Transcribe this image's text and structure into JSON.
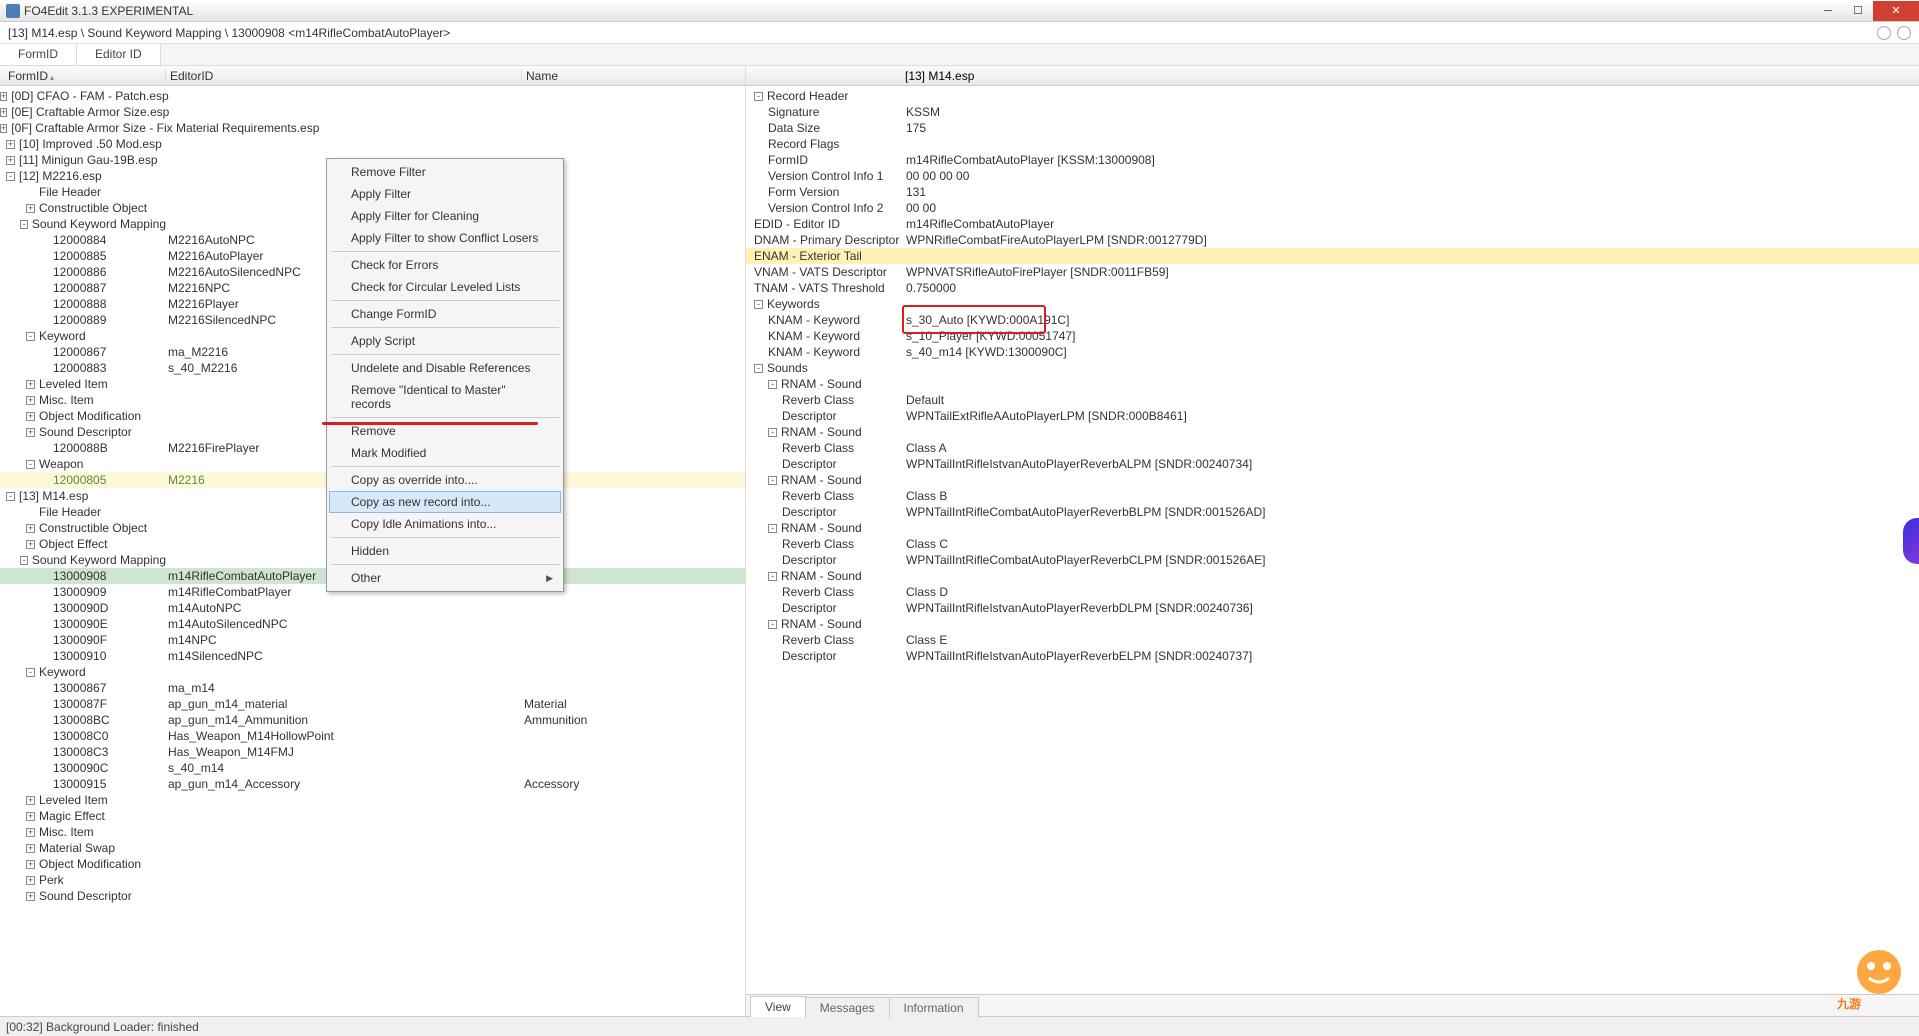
{
  "title": "FO4Edit 3.1.3 EXPERIMENTAL",
  "breadcrumb": "[13] M14.esp \\ Sound Keyword Mapping \\ 13000908 <m14RifleCombatAutoPlayer>",
  "headTabs": {
    "formId": "FormID",
    "editorId": "Editor ID"
  },
  "cols": {
    "formId": "FormID",
    "editorId": "EditorID",
    "name": "Name"
  },
  "tree": [
    {
      "d": 0,
      "e": "+",
      "id": "[0D] CFAO - FAM - Patch.esp",
      "cls": "cut"
    },
    {
      "d": 0,
      "e": "+",
      "id": "[0E] Craftable Armor Size.esp"
    },
    {
      "d": 0,
      "e": "+",
      "id": "[0F] Craftable Armor Size - Fix Material Requirements.esp"
    },
    {
      "d": 0,
      "e": "+",
      "id": "[10] Improved .50 Mod.esp"
    },
    {
      "d": 0,
      "e": "+",
      "id": "[11] Minigun Gau-19B.esp"
    },
    {
      "d": 0,
      "e": "-",
      "id": "[12] M2216.esp"
    },
    {
      "d": 1,
      "e": "",
      "id": "File Header"
    },
    {
      "d": 1,
      "e": "+",
      "id": "Constructible Object"
    },
    {
      "d": 1,
      "e": "-",
      "id": "Sound Keyword Mapping"
    },
    {
      "d": 2,
      "e": "",
      "id": "12000884",
      "ed": "M2216AutoNPC"
    },
    {
      "d": 2,
      "e": "",
      "id": "12000885",
      "ed": "M2216AutoPlayer"
    },
    {
      "d": 2,
      "e": "",
      "id": "12000886",
      "ed": "M2216AutoSilencedNPC"
    },
    {
      "d": 2,
      "e": "",
      "id": "12000887",
      "ed": "M2216NPC"
    },
    {
      "d": 2,
      "e": "",
      "id": "12000888",
      "ed": "M2216Player"
    },
    {
      "d": 2,
      "e": "",
      "id": "12000889",
      "ed": "M2216SilencedNPC"
    },
    {
      "d": 1,
      "e": "-",
      "id": "Keyword"
    },
    {
      "d": 2,
      "e": "",
      "id": "12000867",
      "ed": "ma_M2216"
    },
    {
      "d": 2,
      "e": "",
      "id": "12000883",
      "ed": "s_40_M2216"
    },
    {
      "d": 1,
      "e": "+",
      "id": "Leveled Item"
    },
    {
      "d": 1,
      "e": "+",
      "id": "Misc. Item"
    },
    {
      "d": 1,
      "e": "+",
      "id": "Object Modification"
    },
    {
      "d": 1,
      "e": "+",
      "id": "Sound Descriptor"
    },
    {
      "d": 2,
      "e": "",
      "id": "1200088B",
      "ed": "M2216FirePlayer"
    },
    {
      "d": 1,
      "e": "-",
      "id": "Weapon"
    },
    {
      "d": 2,
      "e": "",
      "id": "12000805",
      "ed": "M2216",
      "hl": true,
      "green": true
    },
    {
      "d": 0,
      "e": "-",
      "id": "[13] M14.esp"
    },
    {
      "d": 1,
      "e": "",
      "id": "File Header"
    },
    {
      "d": 1,
      "e": "+",
      "id": "Constructible Object"
    },
    {
      "d": 1,
      "e": "+",
      "id": "Object Effect"
    },
    {
      "d": 1,
      "e": "-",
      "id": "Sound Keyword Mapping"
    },
    {
      "d": 2,
      "e": "",
      "id": "13000908",
      "ed": "m14RifleCombatAutoPlayer",
      "sel": true
    },
    {
      "d": 2,
      "e": "",
      "id": "13000909",
      "ed": "m14RifleCombatPlayer"
    },
    {
      "d": 2,
      "e": "",
      "id": "1300090D",
      "ed": "m14AutoNPC"
    },
    {
      "d": 2,
      "e": "",
      "id": "1300090E",
      "ed": "m14AutoSilencedNPC"
    },
    {
      "d": 2,
      "e": "",
      "id": "1300090F",
      "ed": "m14NPC"
    },
    {
      "d": 2,
      "e": "",
      "id": "13000910",
      "ed": "m14SilencedNPC"
    },
    {
      "d": 1,
      "e": "-",
      "id": "Keyword"
    },
    {
      "d": 2,
      "e": "",
      "id": "13000867",
      "ed": "ma_m14"
    },
    {
      "d": 2,
      "e": "",
      "id": "1300087F",
      "ed": "ap_gun_m14_material",
      "nm": "Material"
    },
    {
      "d": 2,
      "e": "",
      "id": "130008BC",
      "ed": "ap_gun_m14_Ammunition",
      "nm": "Ammunition"
    },
    {
      "d": 2,
      "e": "",
      "id": "130008C0",
      "ed": "Has_Weapon_M14HollowPoint"
    },
    {
      "d": 2,
      "e": "",
      "id": "130008C3",
      "ed": "Has_Weapon_M14FMJ"
    },
    {
      "d": 2,
      "e": "",
      "id": "1300090C",
      "ed": "s_40_m14"
    },
    {
      "d": 2,
      "e": "",
      "id": "13000915",
      "ed": "ap_gun_m14_Accessory",
      "nm": "Accessory"
    },
    {
      "d": 1,
      "e": "+",
      "id": "Leveled Item"
    },
    {
      "d": 1,
      "e": "+",
      "id": "Magic Effect"
    },
    {
      "d": 1,
      "e": "+",
      "id": "Misc. Item"
    },
    {
      "d": 1,
      "e": "+",
      "id": "Material Swap"
    },
    {
      "d": 1,
      "e": "+",
      "id": "Object Modification"
    },
    {
      "d": 1,
      "e": "+",
      "id": "Perk"
    },
    {
      "d": 1,
      "e": "+",
      "id": "Sound Descriptor"
    }
  ],
  "context": [
    {
      "t": "Remove Filter"
    },
    {
      "t": "Apply Filter"
    },
    {
      "t": "Apply Filter for Cleaning"
    },
    {
      "t": "Apply Filter to show Conflict Losers"
    },
    {
      "sep": true
    },
    {
      "t": "Check for Errors"
    },
    {
      "t": "Check for Circular Leveled Lists"
    },
    {
      "sep": true
    },
    {
      "t": "Change FormID"
    },
    {
      "sep": true
    },
    {
      "t": "Apply Script"
    },
    {
      "sep": true
    },
    {
      "t": "Undelete and Disable References"
    },
    {
      "t": "Remove \"Identical to Master\" records"
    },
    {
      "sep": true
    },
    {
      "t": "Remove"
    },
    {
      "t": "Mark Modified"
    },
    {
      "sep": true
    },
    {
      "t": "Copy as override into...."
    },
    {
      "t": "Copy as new record into...",
      "hov": true
    },
    {
      "t": "Copy Idle Animations into..."
    },
    {
      "sep": true
    },
    {
      "t": "Hidden"
    },
    {
      "sep": true
    },
    {
      "t": "Other",
      "sub": true
    }
  ],
  "rheadVal": "[13] M14.esp",
  "details": [
    {
      "d": 0,
      "e": "-",
      "l": "Record Header"
    },
    {
      "d": 1,
      "l": "Signature",
      "v": "KSSM"
    },
    {
      "d": 1,
      "l": "Data Size",
      "v": "175"
    },
    {
      "d": 1,
      "l": "Record Flags"
    },
    {
      "d": 1,
      "l": "FormID",
      "v": "m14RifleCombatAutoPlayer [KSSM:13000908]"
    },
    {
      "d": 1,
      "l": "Version Control Info 1",
      "v": "00 00 00 00"
    },
    {
      "d": 1,
      "l": "Form Version",
      "v": "131"
    },
    {
      "d": 1,
      "l": "Version Control Info 2",
      "v": "00 00"
    },
    {
      "d": 0,
      "l": "EDID - Editor ID",
      "v": "m14RifleCombatAutoPlayer"
    },
    {
      "d": 0,
      "l": "DNAM - Primary Descriptor",
      "v": "WPNRifleCombatFireAutoPlayerLPM [SNDR:0012779D]"
    },
    {
      "d": 0,
      "l": "ENAM - Exterior Tail",
      "hi": true
    },
    {
      "d": 0,
      "l": "VNAM - VATS Descriptor",
      "v": "WPNVATSRifleAutoFirePlayer [SNDR:0011FB59]"
    },
    {
      "d": 0,
      "l": "TNAM - VATS Threshold",
      "v": "0.750000"
    },
    {
      "d": 0,
      "e": "-",
      "l": "Keywords"
    },
    {
      "d": 1,
      "l": "KNAM - Keyword",
      "v": "s_30_Auto [KYWD:000A191C]"
    },
    {
      "d": 1,
      "l": "KNAM - Keyword",
      "v": "s_10_Player [KYWD:00051747]"
    },
    {
      "d": 1,
      "l": "KNAM - Keyword",
      "v": "s_40_m14 [KYWD:1300090C]"
    },
    {
      "d": 0,
      "e": "-",
      "l": "Sounds"
    },
    {
      "d": 1,
      "e": "-",
      "l": "RNAM - Sound"
    },
    {
      "d": 2,
      "l": "Reverb Class",
      "v": "Default"
    },
    {
      "d": 2,
      "l": "Descriptor",
      "v": "WPNTailExtRifleAAutoPlayerLPM [SNDR:000B8461]"
    },
    {
      "d": 1,
      "e": "-",
      "l": "RNAM - Sound"
    },
    {
      "d": 2,
      "l": "Reverb Class",
      "v": "Class A"
    },
    {
      "d": 2,
      "l": "Descriptor",
      "v": "WPNTailIntRifleIstvanAutoPlayerReverbALPM [SNDR:00240734]"
    },
    {
      "d": 1,
      "e": "-",
      "l": "RNAM - Sound"
    },
    {
      "d": 2,
      "l": "Reverb Class",
      "v": "Class B"
    },
    {
      "d": 2,
      "l": "Descriptor",
      "v": "WPNTailIntRifleCombatAutoPlayerReverbBLPM [SNDR:001526AD]"
    },
    {
      "d": 1,
      "e": "-",
      "l": "RNAM - Sound"
    },
    {
      "d": 2,
      "l": "Reverb Class",
      "v": "Class C"
    },
    {
      "d": 2,
      "l": "Descriptor",
      "v": "WPNTailIntRifleCombatAutoPlayerReverbCLPM [SNDR:001526AE]"
    },
    {
      "d": 1,
      "e": "-",
      "l": "RNAM - Sound"
    },
    {
      "d": 2,
      "l": "Reverb Class",
      "v": "Class D"
    },
    {
      "d": 2,
      "l": "Descriptor",
      "v": "WPNTailIntRifleIstvanAutoPlayerReverbDLPM [SNDR:00240736]"
    },
    {
      "d": 1,
      "e": "-",
      "l": "RNAM - Sound"
    },
    {
      "d": 2,
      "l": "Reverb Class",
      "v": "Class E"
    },
    {
      "d": 2,
      "l": "Descriptor",
      "v": "WPNTailIntRifleIstvanAutoPlayerReverbELPM [SNDR:00240737]"
    }
  ],
  "btabs": {
    "view": "View",
    "messages": "Messages",
    "info": "Information"
  },
  "status": "[00:32] Background Loader: finished",
  "watermark": "九游"
}
